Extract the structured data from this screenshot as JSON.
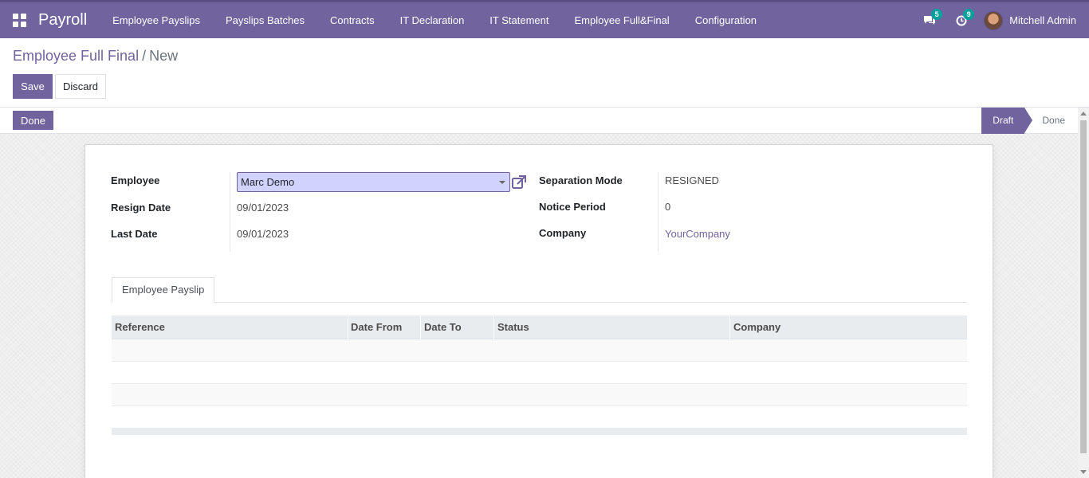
{
  "app": {
    "brand": "Payroll",
    "menu": [
      "Employee Payslips",
      "Payslips Batches",
      "Contracts",
      "IT Declaration",
      "IT Statement",
      "Employee Full&Final",
      "Configuration"
    ],
    "messages_count": "5",
    "activities_count": "9",
    "user_name": "Mitchell Admin"
  },
  "breadcrumb": {
    "parent": "Employee Full Final",
    "separator": "/",
    "current": "New"
  },
  "buttons": {
    "save": "Save",
    "discard": "Discard",
    "done": "Done"
  },
  "statusbar": {
    "stages": [
      "Draft",
      "Done"
    ],
    "active": "Draft"
  },
  "form": {
    "employee_label": "Employee",
    "employee_value": "Marc Demo",
    "resign_date_label": "Resign Date",
    "resign_date_value": "09/01/2023",
    "last_date_label": "Last Date",
    "last_date_value": "09/01/2023",
    "separation_mode_label": "Separation Mode",
    "separation_mode_value": "RESIGNED",
    "notice_period_label": "Notice Period",
    "notice_period_value": "0",
    "company_label": "Company",
    "company_value": "YourCompany"
  },
  "tabs": [
    "Employee Payslip"
  ],
  "table": {
    "columns": [
      "Reference",
      "Date From",
      "Date To",
      "Status",
      "Company"
    ],
    "rows": []
  },
  "colors": {
    "primary": "#71639e",
    "highlight_field": "#d2d2ff",
    "badge": "#00a09d"
  }
}
